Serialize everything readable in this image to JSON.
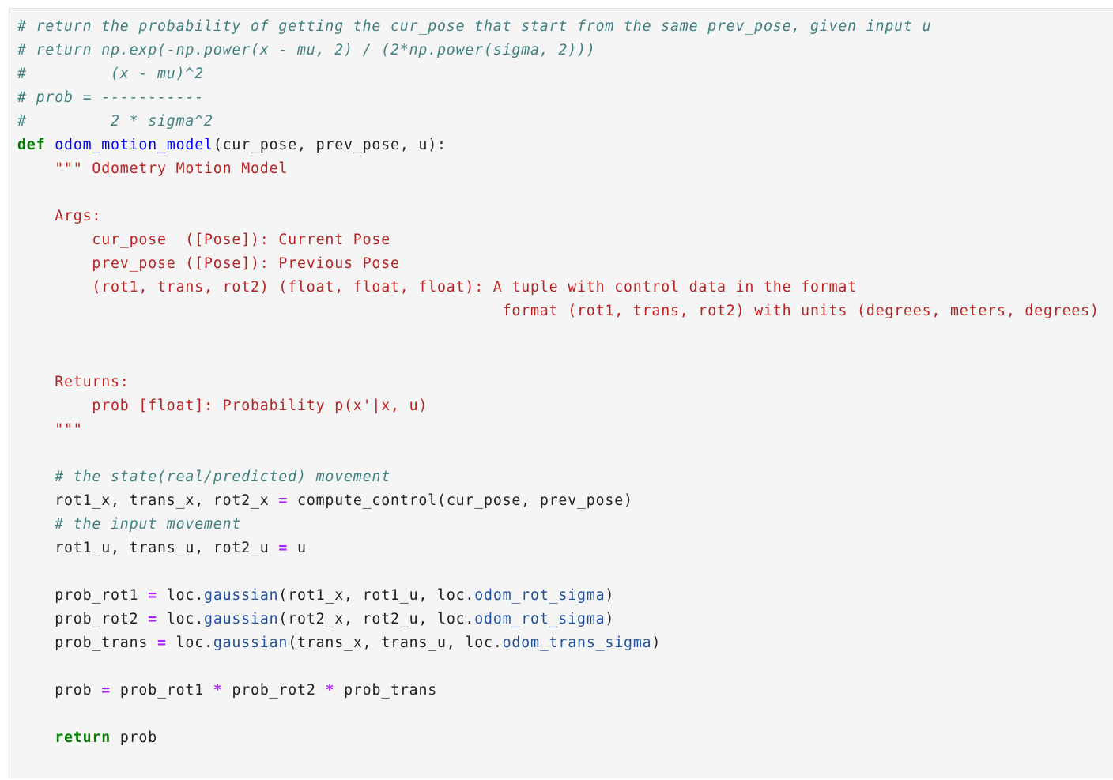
{
  "cell": {
    "language": "python",
    "colors": {
      "background": "#f5f5f5",
      "comment": "#408080",
      "keyword": "#008000",
      "function_name": "#0000ff",
      "string": "#ba2121",
      "operator": "#aa22ff",
      "attribute": "#1f4fa0",
      "text": "#212121"
    },
    "lines": [
      [
        {
          "t": "c",
          "v": "# return the probability of getting the cur_pose that start from the same prev_pose, given input u"
        }
      ],
      [
        {
          "t": "c",
          "v": "# return np.exp(-np.power(x - mu, 2) / (2*np.power(sigma, 2)))"
        }
      ],
      [
        {
          "t": "c",
          "v": "#         (x - mu)^2"
        }
      ],
      [
        {
          "t": "c",
          "v": "# prob = -----------"
        }
      ],
      [
        {
          "t": "c",
          "v": "#         2 * sigma^2"
        }
      ],
      [
        {
          "t": "k",
          "v": "def"
        },
        {
          "t": "p",
          "v": " "
        },
        {
          "t": "nf",
          "v": "odom_motion_model"
        },
        {
          "t": "p",
          "v": "(cur_pose, prev_pose, u):"
        }
      ],
      [
        {
          "t": "p",
          "v": "    "
        },
        {
          "t": "s",
          "v": "\"\"\" Odometry Motion Model"
        }
      ],
      [
        {
          "t": "p",
          "v": ""
        }
      ],
      [
        {
          "t": "p",
          "v": "    "
        },
        {
          "t": "s",
          "v": "Args:"
        }
      ],
      [
        {
          "t": "p",
          "v": "        "
        },
        {
          "t": "s",
          "v": "cur_pose  ([Pose]): Current Pose"
        }
      ],
      [
        {
          "t": "p",
          "v": "        "
        },
        {
          "t": "s",
          "v": "prev_pose ([Pose]): Previous Pose"
        }
      ],
      [
        {
          "t": "p",
          "v": "        "
        },
        {
          "t": "s",
          "v": "(rot1, trans, rot2) (float, float, float): A tuple with control data in the format"
        }
      ],
      [
        {
          "t": "p",
          "v": "                                                    "
        },
        {
          "t": "s",
          "v": "format (rot1, trans, rot2) with units (degrees, meters, degrees)"
        }
      ],
      [
        {
          "t": "p",
          "v": ""
        }
      ],
      [
        {
          "t": "p",
          "v": ""
        }
      ],
      [
        {
          "t": "p",
          "v": "    "
        },
        {
          "t": "s",
          "v": "Returns:"
        }
      ],
      [
        {
          "t": "p",
          "v": "        "
        },
        {
          "t": "s",
          "v": "prob [float]: Probability p(x'|x, u)"
        }
      ],
      [
        {
          "t": "p",
          "v": "    "
        },
        {
          "t": "s",
          "v": "\"\"\""
        }
      ],
      [
        {
          "t": "p",
          "v": ""
        }
      ],
      [
        {
          "t": "p",
          "v": "    "
        },
        {
          "t": "c",
          "v": "# the state(real/predicted) movement"
        }
      ],
      [
        {
          "t": "p",
          "v": "    rot1_x, trans_x, rot2_x "
        },
        {
          "t": "o",
          "v": "="
        },
        {
          "t": "p",
          "v": " compute_control(cur_pose, prev_pose)"
        }
      ],
      [
        {
          "t": "p",
          "v": "    "
        },
        {
          "t": "c",
          "v": "# the input movement"
        }
      ],
      [
        {
          "t": "p",
          "v": "    rot1_u, trans_u, rot2_u "
        },
        {
          "t": "o",
          "v": "="
        },
        {
          "t": "p",
          "v": " u"
        }
      ],
      [
        {
          "t": "p",
          "v": ""
        }
      ],
      [
        {
          "t": "p",
          "v": "    prob_rot1 "
        },
        {
          "t": "o",
          "v": "="
        },
        {
          "t": "p",
          "v": " loc."
        },
        {
          "t": "na",
          "v": "gaussian"
        },
        {
          "t": "p",
          "v": "(rot1_x, rot1_u, loc."
        },
        {
          "t": "na",
          "v": "odom_rot_sigma"
        },
        {
          "t": "p",
          "v": ")"
        }
      ],
      [
        {
          "t": "p",
          "v": "    prob_rot2 "
        },
        {
          "t": "o",
          "v": "="
        },
        {
          "t": "p",
          "v": " loc."
        },
        {
          "t": "na",
          "v": "gaussian"
        },
        {
          "t": "p",
          "v": "(rot2_x, rot2_u, loc."
        },
        {
          "t": "na",
          "v": "odom_rot_sigma"
        },
        {
          "t": "p",
          "v": ")"
        }
      ],
      [
        {
          "t": "p",
          "v": "    prob_trans "
        },
        {
          "t": "o",
          "v": "="
        },
        {
          "t": "p",
          "v": " loc."
        },
        {
          "t": "na",
          "v": "gaussian"
        },
        {
          "t": "p",
          "v": "(trans_x, trans_u, loc."
        },
        {
          "t": "na",
          "v": "odom_trans_sigma"
        },
        {
          "t": "p",
          "v": ")"
        }
      ],
      [
        {
          "t": "p",
          "v": ""
        }
      ],
      [
        {
          "t": "p",
          "v": "    prob "
        },
        {
          "t": "o",
          "v": "="
        },
        {
          "t": "p",
          "v": " prob_rot1 "
        },
        {
          "t": "o",
          "v": "*"
        },
        {
          "t": "p",
          "v": " prob_rot2 "
        },
        {
          "t": "o",
          "v": "*"
        },
        {
          "t": "p",
          "v": " prob_trans"
        }
      ],
      [
        {
          "t": "p",
          "v": ""
        }
      ],
      [
        {
          "t": "p",
          "v": "    "
        },
        {
          "t": "k",
          "v": "return"
        },
        {
          "t": "p",
          "v": " prob"
        }
      ]
    ]
  }
}
